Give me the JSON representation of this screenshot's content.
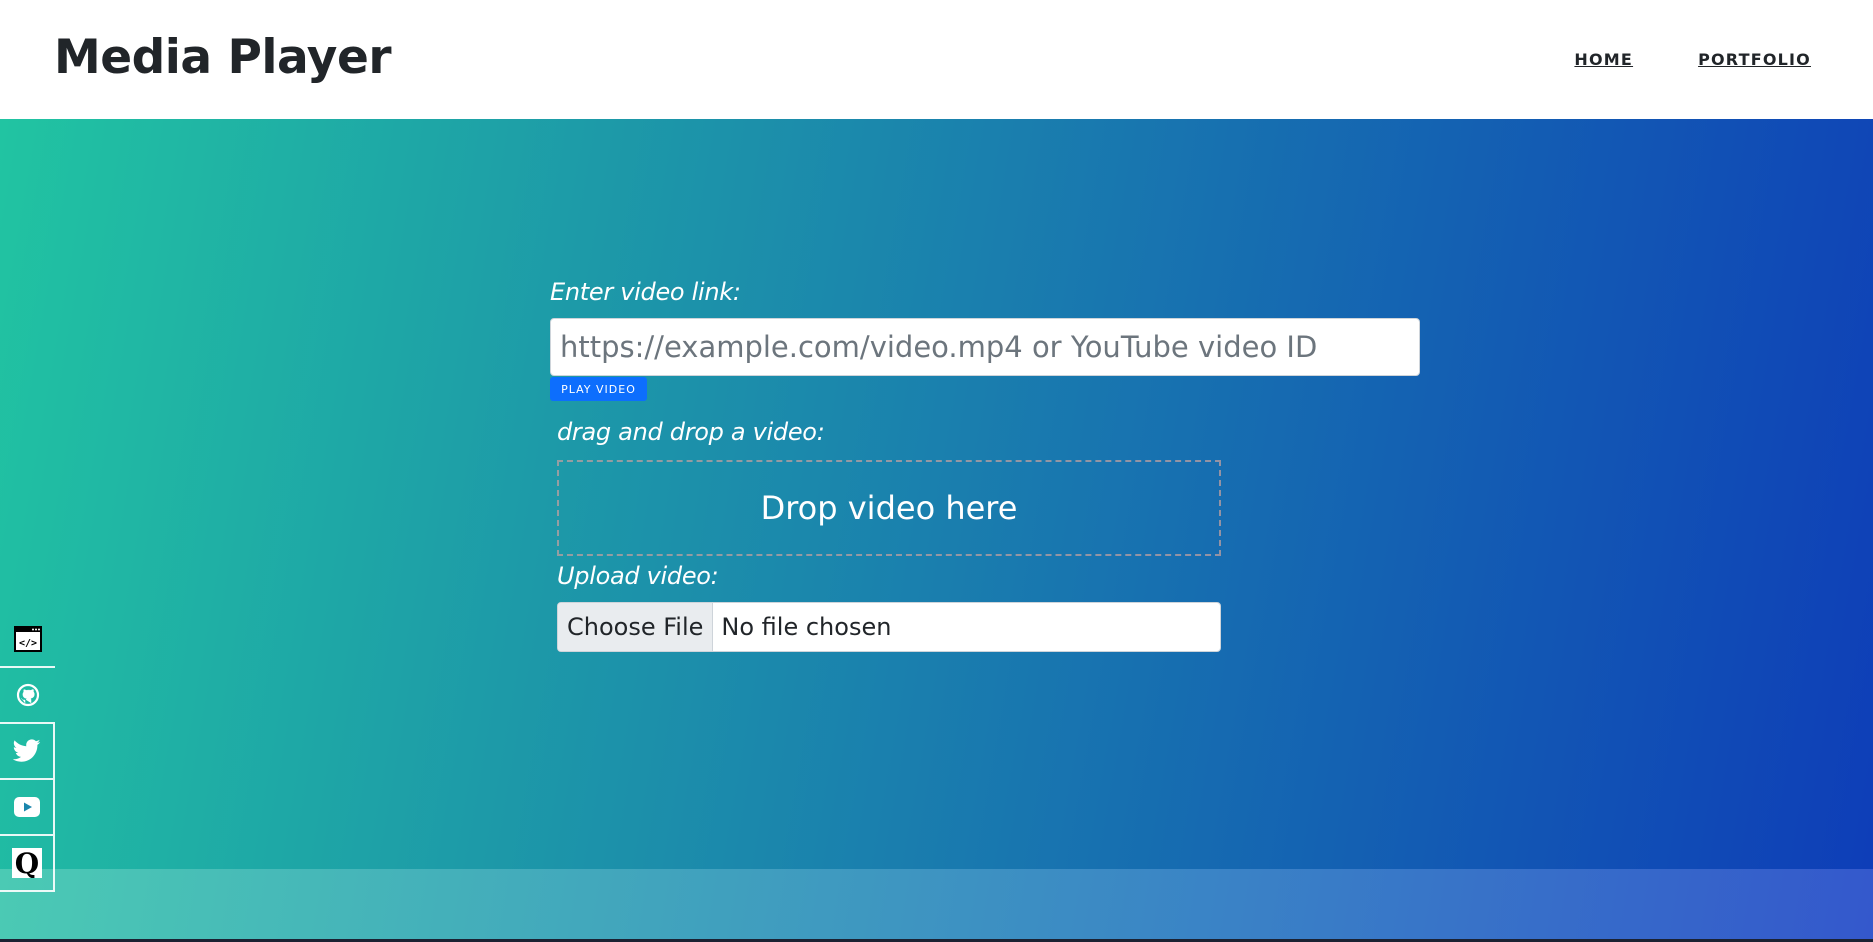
{
  "header": {
    "title": "Media Player",
    "nav": [
      {
        "label": "HOME"
      },
      {
        "label": "PORTFOLIO"
      }
    ]
  },
  "form": {
    "link_label": "Enter video link:",
    "link_placeholder": "https://example.com/video.mp4 or YouTube video ID",
    "link_value": "",
    "play_button": "PLAY VIDEO",
    "drag_label": "drag and drop a video:",
    "drop_zone_text": "Drop video here",
    "upload_label": "Upload video:",
    "choose_file_button": "Choose File",
    "file_status": "No file chosen"
  },
  "social": [
    {
      "icon": "code-window-icon"
    },
    {
      "icon": "github-icon"
    },
    {
      "icon": "twitter-icon"
    },
    {
      "icon": "youtube-icon"
    },
    {
      "icon": "quora-icon",
      "glyph": "Q"
    }
  ],
  "colors": {
    "header_bg": "#ffffff",
    "gradient_start": "#21c4a2",
    "gradient_end": "#0e3db8",
    "primary_button": "#0d6efd",
    "title_text": "#212529"
  }
}
